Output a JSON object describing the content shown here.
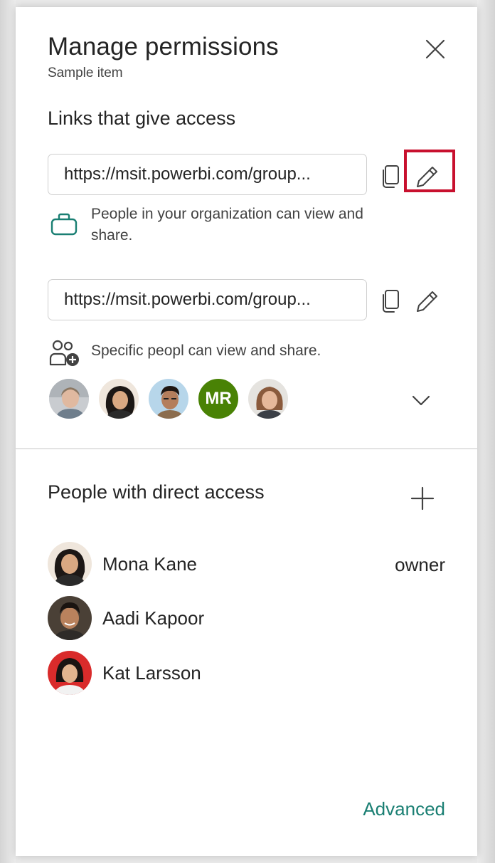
{
  "header": {
    "title": "Manage permissions",
    "subtitle": "Sample item"
  },
  "links_section": {
    "title": "Links that give access",
    "links": [
      {
        "url": "https://msit.powerbi.com/groups/me/reports",
        "url_display": "https://msit.powerbi.com/group...",
        "description": "People in your organization can view and share.",
        "icon": "briefcase-icon",
        "icon_color": "#1a7f73"
      },
      {
        "url": "https://msit.powerbi.com/groups/me/reports",
        "url_display": "https://msit.powerbi.com/group...",
        "description": "Specific peopl can view and share.",
        "icon": "people-add-icon"
      }
    ],
    "avatars": [
      {
        "type": "photo"
      },
      {
        "type": "photo"
      },
      {
        "type": "photo"
      },
      {
        "type": "initials",
        "initials": "MR",
        "color": "#498205"
      },
      {
        "type": "photo"
      }
    ]
  },
  "direct_access": {
    "title": "People with direct access",
    "people": [
      {
        "name": "Mona Kane",
        "role": "owner"
      },
      {
        "name": "Aadi Kapoor",
        "role": ""
      },
      {
        "name": "Kat Larsson",
        "role": ""
      }
    ]
  },
  "footer": {
    "advanced_label": "Advanced"
  },
  "colors": {
    "accent": "#1a7f73",
    "highlight": "#c8102e"
  }
}
